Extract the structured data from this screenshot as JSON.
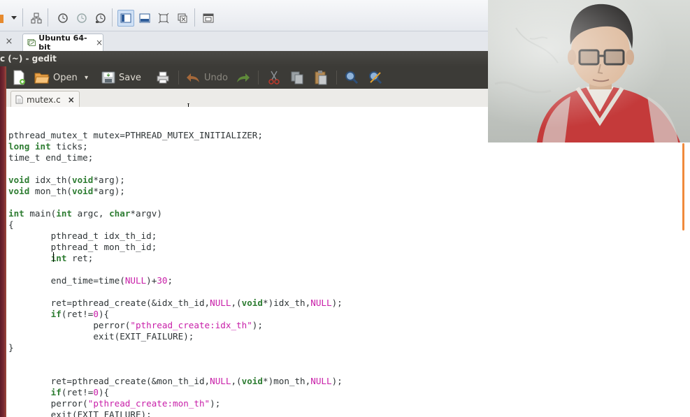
{
  "vm_tabs": {
    "prev_tab_close": "×",
    "active_tab": {
      "label": "Ubuntu 64-bit",
      "close": "×"
    }
  },
  "window": {
    "title": "c (~) - gedit"
  },
  "gedit_toolbar": {
    "open_label": "Open",
    "open_dropdown": "▾",
    "save_label": "Save",
    "undo_label": "Undo"
  },
  "doc_tab": {
    "label": "mutex.c",
    "close": "×"
  },
  "colors": {
    "keyword": "#2e7d32",
    "literal": "#c81ea8",
    "title_bar": "#3c3b37",
    "scroll_thumb": "#f08a3c"
  },
  "code_lines": [
    [],
    [
      {
        "t": "pthread_mutex_t mutex=PTHREAD_MUTEX_INITIALIZER;"
      }
    ],
    [
      {
        "t": "long",
        "c": "kw"
      },
      {
        "t": " "
      },
      {
        "t": "int",
        "c": "kw"
      },
      {
        "t": " ticks;"
      }
    ],
    [
      {
        "t": "time_t end_time;"
      }
    ],
    [],
    [
      {
        "t": "void",
        "c": "kw"
      },
      {
        "t": " idx_th("
      },
      {
        "t": "void",
        "c": "kw"
      },
      {
        "t": "*arg);"
      }
    ],
    [
      {
        "t": "void",
        "c": "kw"
      },
      {
        "t": " mon_th("
      },
      {
        "t": "void",
        "c": "kw"
      },
      {
        "t": "*arg);"
      }
    ],
    [],
    [
      {
        "t": "int",
        "c": "kw"
      },
      {
        "t": " main("
      },
      {
        "t": "int",
        "c": "kw"
      },
      {
        "t": " argc, "
      },
      {
        "t": "char",
        "c": "kw"
      },
      {
        "t": "*argv)"
      }
    ],
    [
      {
        "t": "{"
      }
    ],
    [
      {
        "t": "        pthread_t idx_th_id;"
      }
    ],
    [
      {
        "t": "        pthread_t mon_th_id;"
      }
    ],
    [
      {
        "t": "        "
      },
      {
        "t": "int",
        "c": "kw"
      },
      {
        "t": " ret;"
      }
    ],
    [
      {
        "t": "        "
      }
    ],
    [
      {
        "t": "        end_time=time("
      },
      {
        "t": "NULL",
        "c": "str"
      },
      {
        "t": ")+"
      },
      {
        "t": "30",
        "c": "num"
      },
      {
        "t": ";"
      }
    ],
    [],
    [
      {
        "t": "        ret=pthread_create(&idx_th_id,"
      },
      {
        "t": "NULL",
        "c": "str"
      },
      {
        "t": ",("
      },
      {
        "t": "void",
        "c": "kw"
      },
      {
        "t": "*)idx_th,"
      },
      {
        "t": "NULL",
        "c": "str"
      },
      {
        "t": ");"
      }
    ],
    [
      {
        "t": "        "
      },
      {
        "t": "if",
        "c": "kw"
      },
      {
        "t": "(ret!="
      },
      {
        "t": "0",
        "c": "num"
      },
      {
        "t": "){"
      }
    ],
    [
      {
        "t": "                perror("
      },
      {
        "t": "\"pthread_create:idx_th\"",
        "c": "str"
      },
      {
        "t": ");"
      }
    ],
    [
      {
        "t": "                exit(EXIT_FAILURE);"
      }
    ],
    [
      {
        "t": "}"
      }
    ],
    [],
    [],
    [
      {
        "t": "        ret=pthread_create(&mon_th_id,"
      },
      {
        "t": "NULL",
        "c": "str"
      },
      {
        "t": ",("
      },
      {
        "t": "void",
        "c": "kw"
      },
      {
        "t": "*)mon_th,"
      },
      {
        "t": "NULL",
        "c": "str"
      },
      {
        "t": ");"
      }
    ],
    [
      {
        "t": "        "
      },
      {
        "t": "if",
        "c": "kw"
      },
      {
        "t": "(ret!="
      },
      {
        "t": "0",
        "c": "num"
      },
      {
        "t": "){"
      }
    ],
    [
      {
        "t": "        perror("
      },
      {
        "t": "\"pthread_create:mon_th\"",
        "c": "str"
      },
      {
        "t": ");"
      }
    ],
    [
      {
        "t": "        exit(EXIT_FAILURE);"
      }
    ],
    [
      {
        "t": "}"
      }
    ]
  ]
}
